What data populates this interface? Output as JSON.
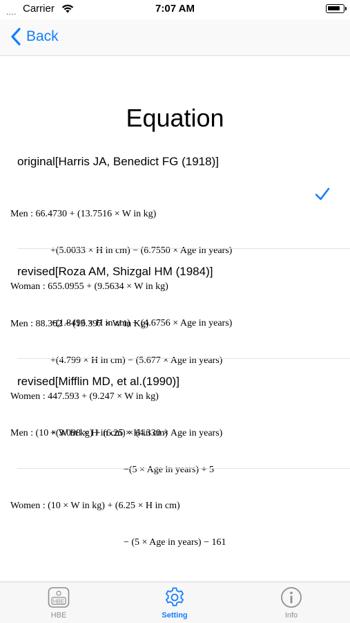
{
  "status": {
    "carrier": "Carrier",
    "time": "7:07 AM",
    "signal": "....",
    "icons": [
      "wifi-icon",
      "battery-icon"
    ]
  },
  "nav": {
    "back_label": "Back",
    "icon": "chevron-left-icon"
  },
  "title": "Equation",
  "sections": [
    {
      "title": "original[Harris JA, Benedict FG (1918)]",
      "selected": true,
      "lines": [
        "Men : 66.4730 + (13.7516 × W in kg)",
        "+(5.0033 × H in cm) − (6.7550 × Age in years)",
        "Woman : 655.0955 + (9.5634 × W in kg)",
        "+(1.8496 × H in cm) − (4.6756 × Age in years)"
      ]
    },
    {
      "title": "revised[Roza AM, Shizgal HM (1984)]",
      "selected": false,
      "lines": [
        "Men : 88.362 + (13.397 × W in Kg)",
        "+(4.799 × H in cm) − (5.677 × Age in years)",
        "Women : 447.593 + (9.247 × W in kg)",
        "+(3.098 × H in cm) × (4.330 × Age in years)"
      ]
    },
    {
      "title": "revised[Mifflin MD, et al.(1990)]",
      "selected": false,
      "lines": [
        "Men : (10 × W in kg) + (6.25 × H in cm)",
        "−(5 × Age in years) + 5",
        "Women : (10 × W in kg) + (6.25 × H in cm)",
        "− (5 × Age in years) − 161"
      ]
    }
  ],
  "tabs": [
    {
      "label": "HBE",
      "icon": "hbe-logo-icon",
      "active": false,
      "icon_text": "HBE"
    },
    {
      "label": "Setting",
      "icon": "gear-icon",
      "active": true
    },
    {
      "label": "Info",
      "icon": "info-icon",
      "active": false
    }
  ],
  "colors": {
    "accent": "#147efb",
    "inactive": "#8e8e93"
  }
}
